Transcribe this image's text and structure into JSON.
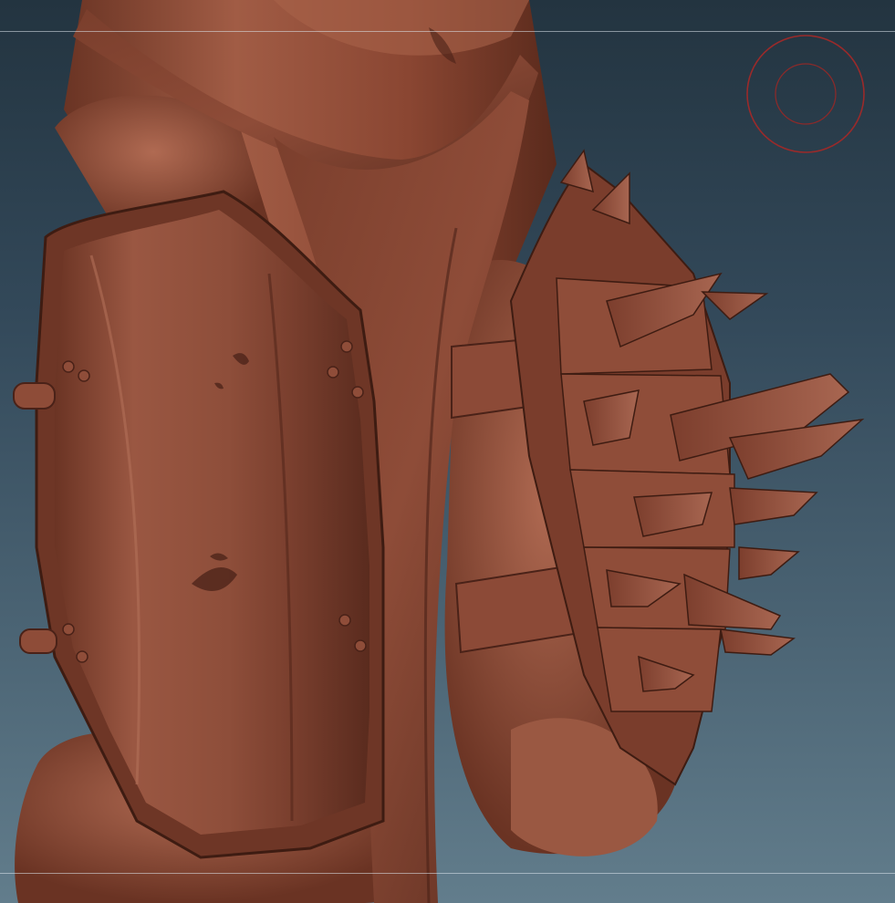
{
  "viewport": {
    "background_top": "#233440",
    "background_bottom": "#627d8c",
    "model_material_color": "#8a4a38",
    "model_shadow_color": "#4a2218",
    "model_highlight_color": "#b5735b"
  },
  "brush_cursor": {
    "icon": "brush-cursor-icon",
    "ring_color": "#9a2a2a"
  },
  "guides": {
    "color": "#dfe6ea"
  }
}
